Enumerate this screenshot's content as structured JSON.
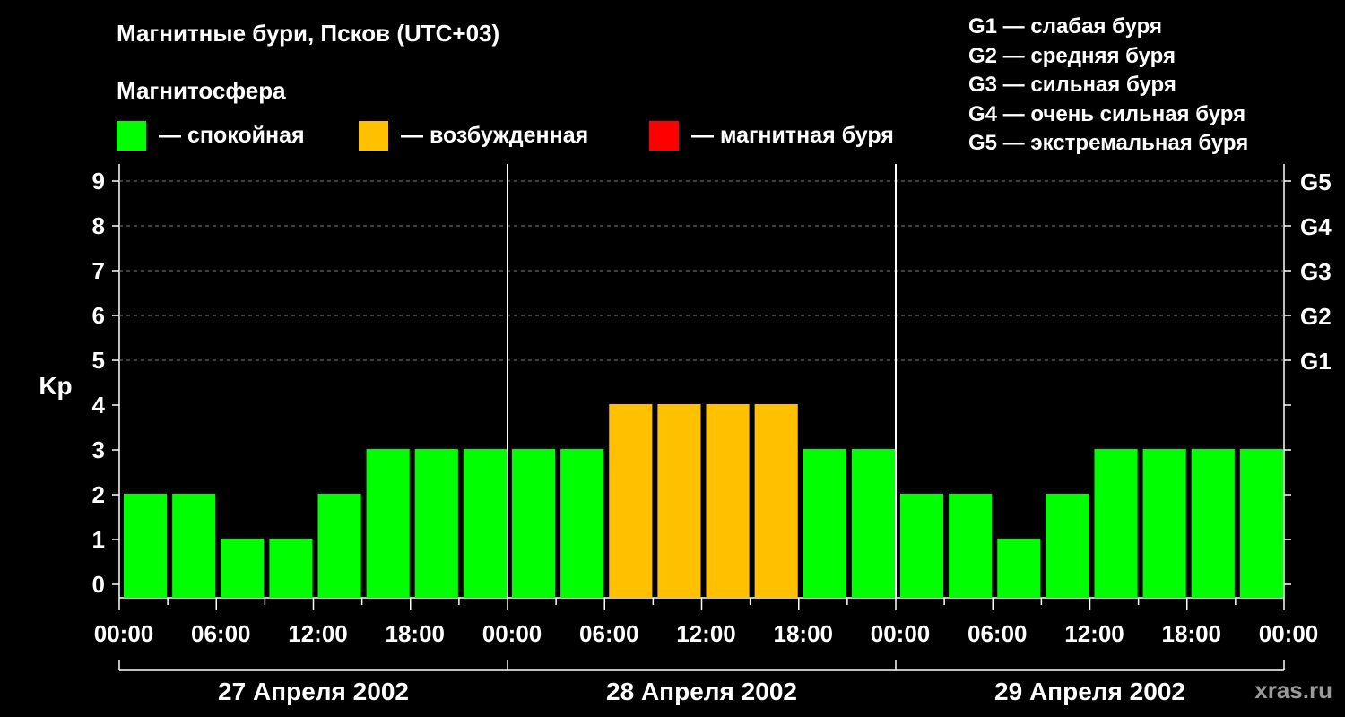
{
  "title": "Магнитные бури, Псков (UTC+03)",
  "subtitle": "Магнитосфера",
  "legend": [
    {
      "color": "#00ff00",
      "label": "— спокойная"
    },
    {
      "color": "#ffc000",
      "label": "— возбужденная"
    },
    {
      "color": "#ff0000",
      "label": "— магнитная буря"
    }
  ],
  "g_legend": [
    "G1 — слабая буря",
    "G2 — средняя буря",
    "G3 — сильная буря",
    "G4 — очень сильная буря",
    "G5 — экстремальная буря"
  ],
  "watermark": "xras.ru",
  "chart_data": {
    "type": "bar",
    "ylabel": "Kp",
    "ylim": [
      0,
      9
    ],
    "y_ticks": [
      "0",
      "1",
      "2",
      "3",
      "4",
      "5",
      "6",
      "7",
      "8",
      "9"
    ],
    "right_ticks": [
      {
        "value": 5,
        "label": "G1"
      },
      {
        "value": 6,
        "label": "G2"
      },
      {
        "value": 7,
        "label": "G3"
      },
      {
        "value": 8,
        "label": "G4"
      },
      {
        "value": 9,
        "label": "G5"
      }
    ],
    "x_tick_labels": [
      "00:00",
      "06:00",
      "12:00",
      "18:00",
      "00:00",
      "06:00",
      "12:00",
      "18:00",
      "00:00",
      "06:00",
      "12:00",
      "18:00",
      "00:00"
    ],
    "days": [
      "27 Апреля 2002",
      "28 Апреля 2002",
      "29 Апреля 2002"
    ],
    "interval_hours": 3,
    "values": [
      2,
      2,
      1,
      1,
      2,
      3,
      3,
      3,
      3,
      3,
      4,
      4,
      4,
      4,
      3,
      3,
      2,
      2,
      1,
      2,
      3,
      3,
      3,
      3
    ],
    "colors": {
      "quiet": "#00ff00",
      "active": "#ffc000",
      "storm": "#ff0000"
    },
    "grid": true
  }
}
